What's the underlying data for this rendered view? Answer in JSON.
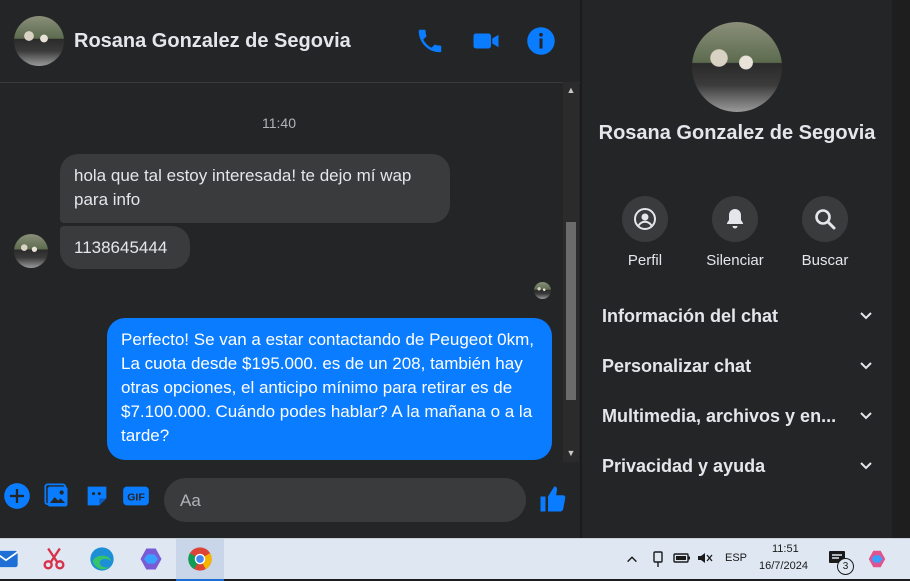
{
  "colors": {
    "accent": "#0a7cff",
    "background": "#242526",
    "bubble_incoming": "#3a3b3c",
    "text": "#e4e6eb"
  },
  "chat": {
    "header": {
      "contact_name": "Rosana Gonzalez de Segovia",
      "icons": [
        "phone-icon",
        "video-call-icon",
        "info-icon"
      ]
    },
    "timestamp": "11:40",
    "messages": [
      {
        "direction": "in",
        "text": "hola que tal estoy interesada! te dejo mí wap para info"
      },
      {
        "direction": "in",
        "text": "1138645444"
      },
      {
        "direction": "out",
        "text": "Perfecto!  Se van a estar contactando de Peugeot 0km, La cuota desde $195.000. es de un 208, también hay otras opciones, el anticipo mínimo para retirar es de $7.100.000. Cuándo podes hablar? A la mañana o a la tarde?"
      }
    ],
    "composer": {
      "placeholder": "Aa",
      "icons": [
        "add-icon",
        "photo-icon",
        "sticker-icon",
        "gif-icon",
        "emoji-icon",
        "like-icon"
      ]
    }
  },
  "details": {
    "name": "Rosana Gonzalez de Segovia",
    "actions": [
      {
        "label": "Perfil",
        "icon": "profile-icon"
      },
      {
        "label": "Silenciar",
        "icon": "bell-icon"
      },
      {
        "label": "Buscar",
        "icon": "search-icon"
      }
    ],
    "sections": [
      {
        "label": "Información del chat"
      },
      {
        "label": "Personalizar chat"
      },
      {
        "label": "Multimedia, archivos y en..."
      },
      {
        "label": "Privacidad y ayuda"
      }
    ]
  },
  "taskbar": {
    "apps": [
      "mail-icon",
      "snipping-tool-icon",
      "edge-icon",
      "copilot-icon",
      "chrome-icon"
    ],
    "language": "ESP",
    "time": "11:51",
    "date": "16/7/2024",
    "notification_count": "3"
  }
}
